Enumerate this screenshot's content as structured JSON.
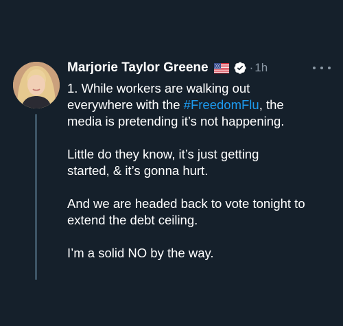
{
  "tweet": {
    "author": "Marjorie Taylor Greene",
    "time": "1h",
    "dot": "·",
    "line1_pre": "1. While workers are walking out",
    "line2_pre": "everywhere with the ",
    "hashtag": "#FreedomFlu",
    "line2_post": ", the",
    "line3": "media is pretending it’s not happening.",
    "para2_l1": "Little do they know, it’s just getting",
    "para2_l2": "started, & it’s gonna hurt.",
    "para3_l1": "And we are headed back to vote tonight to",
    "para3_l2": "extend the debt ceiling.",
    "para4": "I’m a solid NO by the way."
  },
  "icons": {
    "flag": "us-flag-icon",
    "verified": "verified-badge-icon",
    "more": "more-options-icon"
  },
  "colors": {
    "background": "#15202b",
    "text": "#ffffff",
    "secondary": "#8b98a5",
    "link": "#1d9bf0",
    "thread_line": "#3d5466"
  }
}
